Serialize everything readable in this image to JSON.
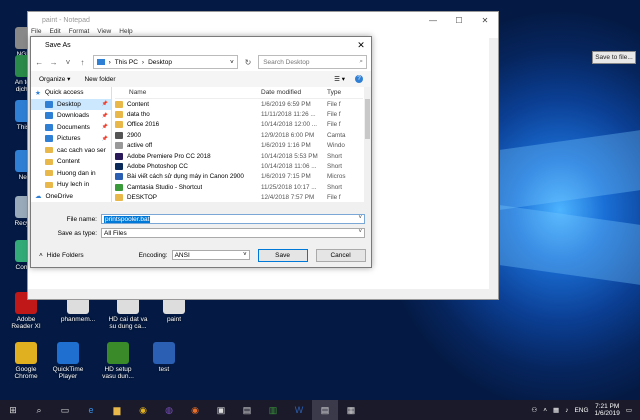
{
  "desktop": {
    "tooltip": "Save to file...",
    "icons": [
      {
        "label": "NGUY\nANH K",
        "color": "#888"
      },
      {
        "label": "An toàn\ndịch tài",
        "color": "#2a8a4a"
      },
      {
        "label": "This P",
        "color": "#2f7fd4"
      },
      {
        "label": "Netw",
        "color": "#2f7fd4"
      },
      {
        "label": "Recycle",
        "color": "#9ab"
      },
      {
        "label": "Control",
        "color": "#3a7"
      },
      {
        "label": "Adobe\nReader XI",
        "color": "#c01818"
      },
      {
        "label": "phanmem...",
        "color": "#ddd"
      },
      {
        "label": "HD cai dat va\nsu dung ca...",
        "color": "#ddd"
      },
      {
        "label": "paint",
        "color": "#ddd"
      },
      {
        "label": "Google\nChrome",
        "color": "#e0b020"
      },
      {
        "label": "QuickTime\nPlayer",
        "color": "#1e6fd0"
      },
      {
        "label": "HD setup\nvasu dun...",
        "color": "#3a8a2a"
      },
      {
        "label": "test",
        "color": "#2b5fb3"
      }
    ]
  },
  "notepad": {
    "title": "paint - Notepad",
    "menu": [
      "File",
      "Edit",
      "Format",
      "View",
      "Help"
    ]
  },
  "dialog": {
    "title": "Save As",
    "address": [
      "This PC",
      "Desktop"
    ],
    "search_placeholder": "Search Desktop",
    "organize": "Organize ▾",
    "new_folder": "New folder",
    "columns": {
      "name": "Name",
      "date": "Date modified",
      "type": "Type"
    },
    "tree": [
      {
        "label": "Quick access",
        "icon": "star",
        "pin": false
      },
      {
        "label": "Desktop",
        "icon": "blue",
        "pin": true,
        "selected": true
      },
      {
        "label": "Downloads",
        "icon": "blue",
        "pin": true
      },
      {
        "label": "Documents",
        "icon": "blue",
        "pin": true
      },
      {
        "label": "Pictures",
        "icon": "blue",
        "pin": true
      },
      {
        "label": "cac cach vao ser",
        "icon": "folder",
        "pin": false
      },
      {
        "label": "Content",
        "icon": "folder",
        "pin": false
      },
      {
        "label": "Huong dan in",
        "icon": "folder",
        "pin": false
      },
      {
        "label": "Huy lech in",
        "icon": "folder",
        "pin": false
      },
      {
        "label": "OneDrive",
        "icon": "cloud",
        "pin": false
      }
    ],
    "files": [
      {
        "name": "Content",
        "date": "1/6/2019 6:59 PM",
        "type": "File f",
        "color": "#e8b84a"
      },
      {
        "name": "data tho",
        "date": "11/11/2018 11:26 ...",
        "type": "File f",
        "color": "#e8b84a"
      },
      {
        "name": "Office 2016",
        "date": "10/14/2018 12:00 ...",
        "type": "File f",
        "color": "#e8b84a"
      },
      {
        "name": "2900",
        "date": "12/9/2018 6:00 PM",
        "type": "Camta",
        "color": "#555"
      },
      {
        "name": "active off",
        "date": "1/6/2019 1:16 PM",
        "type": "Windo",
        "color": "#999"
      },
      {
        "name": "Adobe Premiere Pro CC 2018",
        "date": "10/14/2018 5:53 PM",
        "type": "Short",
        "color": "#2a1a5a"
      },
      {
        "name": "Adobe Photoshop CC",
        "date": "10/14/2018 11:06 ...",
        "type": "Short",
        "color": "#0a2a5a"
      },
      {
        "name": "Bài viết cách sử dụng máy in Canon 2900",
        "date": "1/6/2019 7:15 PM",
        "type": "Micros",
        "color": "#2b5fb3"
      },
      {
        "name": "Camtasia Studio - Shortcut",
        "date": "11/25/2018 10:17 ...",
        "type": "Short",
        "color": "#3a9a3a"
      },
      {
        "name": "DESKTOP",
        "date": "12/4/2018 7:57 PM",
        "type": "File f",
        "color": "#e8b84a"
      }
    ],
    "file_name_label": "File name:",
    "file_name_value": "printspooler.bat",
    "save_type_label": "Save as type:",
    "save_type_value": "All Files",
    "hide_folders": "Hide Folders",
    "encoding_label": "Encoding:",
    "encoding_value": "ANSI",
    "save_btn": "Save",
    "cancel_btn": "Cancel"
  },
  "taskbar": {
    "time": "7:21 PM",
    "date": "1/6/2019",
    "lang": "ENG"
  }
}
